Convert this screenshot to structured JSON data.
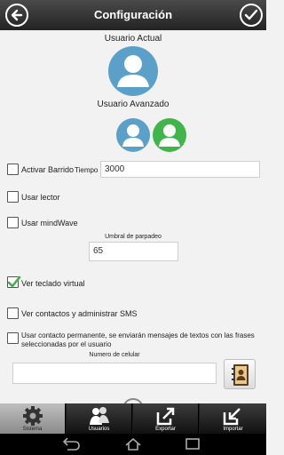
{
  "header": {
    "title": "Configuración",
    "back_icon": "back-arrow-icon",
    "confirm_icon": "checkmark-icon"
  },
  "users": {
    "current_label": "Usuario Actual",
    "advanced_label": "Usuario Avanzado"
  },
  "settings": {
    "sweep": {
      "label": "Activar Barrido",
      "checked": false,
      "time_label": "Tiempo",
      "time_value": "3000"
    },
    "reader": {
      "label": "Usar lector",
      "checked": false
    },
    "mindwave": {
      "label": "Usar mindWave",
      "checked": false,
      "blink_threshold_label": "Umbral de parpadeo",
      "blink_threshold_value": "65"
    },
    "virtual_keyboard": {
      "label": "Ver teclado virtual",
      "checked": true
    },
    "contacts_sms": {
      "label": "Ver contactos y administrar SMS",
      "checked": false
    },
    "permanent_contact": {
      "label": "Usar contacto permanente, se enviarán mensajes de textos con las frases seleccionadas por el usuario",
      "checked": false
    },
    "cell_number": {
      "label": "Numero de celular",
      "value": ""
    }
  },
  "tabs": [
    {
      "label": "Sistema",
      "icon": "gear-icon",
      "active": true
    },
    {
      "label": "Usuarios",
      "icon": "users-icon",
      "active": false
    },
    {
      "label": "Exportar",
      "icon": "export-icon",
      "active": false
    },
    {
      "label": "Importar",
      "icon": "import-icon",
      "active": false
    }
  ],
  "colors": {
    "header_bg": "#2e2e2e",
    "avatar_blue": "#5aa0c8",
    "avatar_green": "#3fb54a",
    "check_green": "#3bb24a"
  }
}
